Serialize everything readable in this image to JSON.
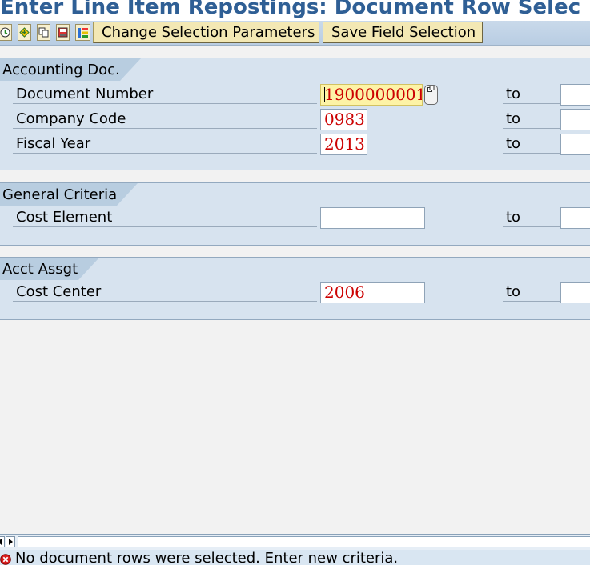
{
  "title": "Enter Line Item Repostings: Document Row Selec",
  "toolbar": {
    "icons": [
      "execute-icon",
      "get-variant-icon",
      "copy-icon",
      "save-variant-icon",
      "dynamic-selection-icon"
    ],
    "change_selection_label": "Change Selection Parameters",
    "save_field_selection_label": "Save Field Selection"
  },
  "groups": {
    "accounting_doc": {
      "title": "Accounting Doc.",
      "rows": [
        {
          "label": "Document Number",
          "from": "1900000001",
          "to_label": "to",
          "to_value": ""
        },
        {
          "label": "Company Code",
          "from": "0983",
          "to_label": "to",
          "to_value": ""
        },
        {
          "label": "Fiscal Year",
          "from": "2013",
          "to_label": "to",
          "to_value": ""
        }
      ]
    },
    "general_criteria": {
      "title": "General Criteria",
      "rows": [
        {
          "label": "Cost Element",
          "from": "",
          "to_label": "to",
          "to_value": ""
        }
      ]
    },
    "acct_assgt": {
      "title": "Acct Assgt",
      "rows": [
        {
          "label": "Cost Center",
          "from": "2006",
          "to_label": "to",
          "to_value": ""
        }
      ]
    }
  },
  "status": {
    "type": "error",
    "message": "No document rows were selected. Enter new criteria."
  },
  "colors": {
    "title": "#2f5f95",
    "group_background": "#d7e3ef",
    "field_value": "#cc0000",
    "focused_field": "#fdf3a6"
  }
}
